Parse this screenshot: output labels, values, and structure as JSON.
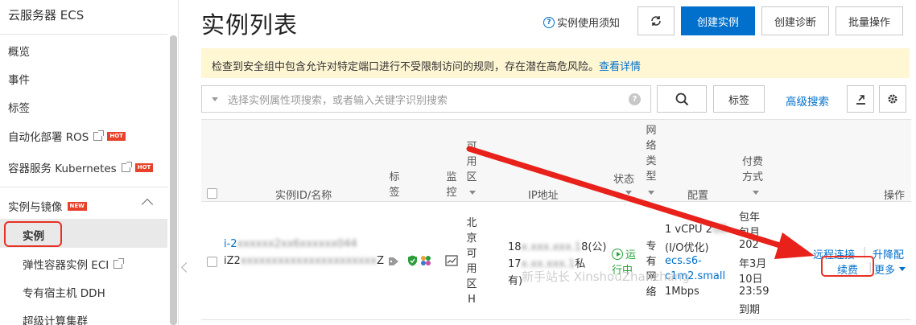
{
  "sidebar": {
    "title": "云服务器 ECS",
    "items": [
      {
        "label": "概览"
      },
      {
        "label": "事件"
      },
      {
        "label": "标签"
      },
      {
        "label": "自动化部署 ROS",
        "badge": "HOT"
      },
      {
        "label": "容器服务 Kubernetes",
        "badge": "HOT"
      }
    ],
    "group": {
      "label": "实例与镜像",
      "badge": "NEW"
    },
    "sub_items": [
      {
        "label": "实例"
      },
      {
        "label": "弹性容器实例 ECI"
      },
      {
        "label": "专有宿主机 DDH"
      },
      {
        "label": "超级计算集群"
      }
    ]
  },
  "header": {
    "title": "实例列表",
    "help_label": "实例使用须知",
    "refresh_icon": "refresh-icon",
    "create_instance": "创建实例",
    "create_diagnosis": "创建诊断",
    "batch_ops": "批量操作"
  },
  "alert": {
    "text": "检查到安全组中包含允许对特定端口进行不受限制访问的规则，存在潜在高危风险。",
    "link": "查看详情"
  },
  "search": {
    "placeholder": "选择实例属性项搜索，或者输入关键字识别搜索",
    "tag_label": "标签",
    "advanced": "高级搜索"
  },
  "table": {
    "headers": {
      "id_name": "实例ID/名称",
      "tags": "标签",
      "monitor": "监控",
      "zone": "可用区",
      "ip": "IP地址",
      "status": "状态",
      "network": "网络类型",
      "config": "配置",
      "billing": "付费方式",
      "ops": "操作"
    },
    "row": {
      "id": "i-2",
      "id_blurred": "xxxxxx2xx6xxxxxx044",
      "name": "iZ2",
      "name_blurred": "xxxxxxxxxxxxxxxxxxxxxx",
      "name_tail": "Z",
      "zone": "北京可用区H",
      "ip_line1": "18",
      "ip_line1_blur": "x.xxx.xxx.1",
      "ip_line1_tail": "8(公)",
      "ip_line2": "17",
      "ip_line2_blur": "x.xx.xxx.1",
      "ip_line2_tail": "私",
      "ip_line3": "有)",
      "status_l1": "运",
      "status_l2": "行中",
      "network": "专有网络",
      "config_l1": "1 vCPU 2",
      "config_l2": "(I/O优化)",
      "config_l3": "ecs.s6-",
      "config_l4": "c1m2.small",
      "config_l5": "1Mbps",
      "billing_l1": "包年",
      "billing_l2": "包月",
      "billing_l3": "202",
      "billing_l4": "年3月",
      "billing_l5": "10日",
      "billing_l6": "23:59",
      "billing_l7": "到期",
      "op_remote": "远程连接",
      "op_upgrade": "升降配",
      "op_renew": "续费",
      "op_more": "更多"
    }
  },
  "watermark": "新手站长 XinshouZhanzhang"
}
